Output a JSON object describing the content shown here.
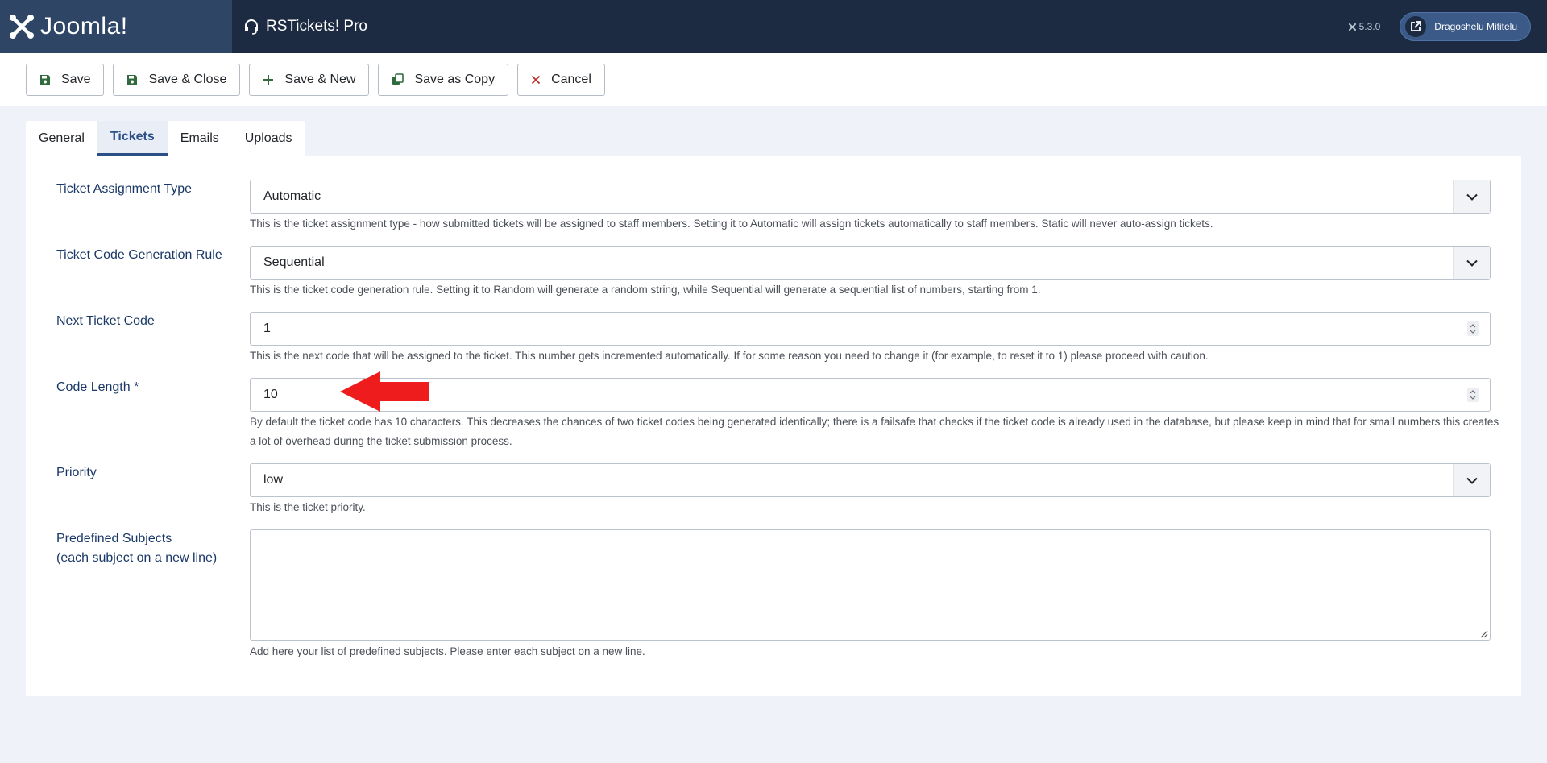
{
  "header": {
    "brand": "Joomla!",
    "page_title": "RSTickets! Pro",
    "version": "5.3.0",
    "user": "Dragoshelu Mititelu"
  },
  "toolbar": {
    "save": "Save",
    "save_close": "Save & Close",
    "save_new": "Save & New",
    "save_copy": "Save as Copy",
    "cancel": "Cancel"
  },
  "tabs": [
    "General",
    "Tickets",
    "Emails",
    "Uploads"
  ],
  "active_tab": "Tickets",
  "fields": {
    "assignment": {
      "label": "Ticket Assignment Type",
      "value": "Automatic",
      "help": "This is the ticket assignment type - how submitted tickets will be assigned to staff members. Setting it to Automatic will assign tickets automatically to staff members. Static will never auto-assign tickets."
    },
    "code_rule": {
      "label": "Ticket Code Generation Rule",
      "value": "Sequential",
      "help": "This is the ticket code generation rule. Setting it to Random will generate a random string, while Sequential will generate a sequential list of numbers, starting from 1."
    },
    "next_code": {
      "label": "Next Ticket Code",
      "value": "1",
      "help": "This is the next code that will be assigned to the ticket. This number gets incremented automatically. If for some reason you need to change it (for example, to reset it to 1) please proceed with caution."
    },
    "code_length": {
      "label": "Code Length *",
      "value": "10",
      "help": "By default the ticket code has 10 characters. This decreases the chances of two ticket codes being generated identically; there is a failsafe that checks if the ticket code is already used in the database, but please keep in mind that for small numbers this creates a lot of overhead during the ticket submission process."
    },
    "priority": {
      "label": "Priority",
      "value": "low",
      "help": "This is the ticket priority."
    },
    "subjects": {
      "label_line1": "Predefined Subjects",
      "label_line2": "(each subject on a new line)",
      "value": "",
      "help": "Add here your list of predefined subjects. Please enter each subject on a new line."
    }
  },
  "colors": {
    "header_bg": "#1c2b41",
    "brand_bg": "#2f4566",
    "label": "#1a3867",
    "save_icon": "#2f6b3d",
    "cancel_icon": "#c52827",
    "annotation": "#ee1c1c"
  }
}
